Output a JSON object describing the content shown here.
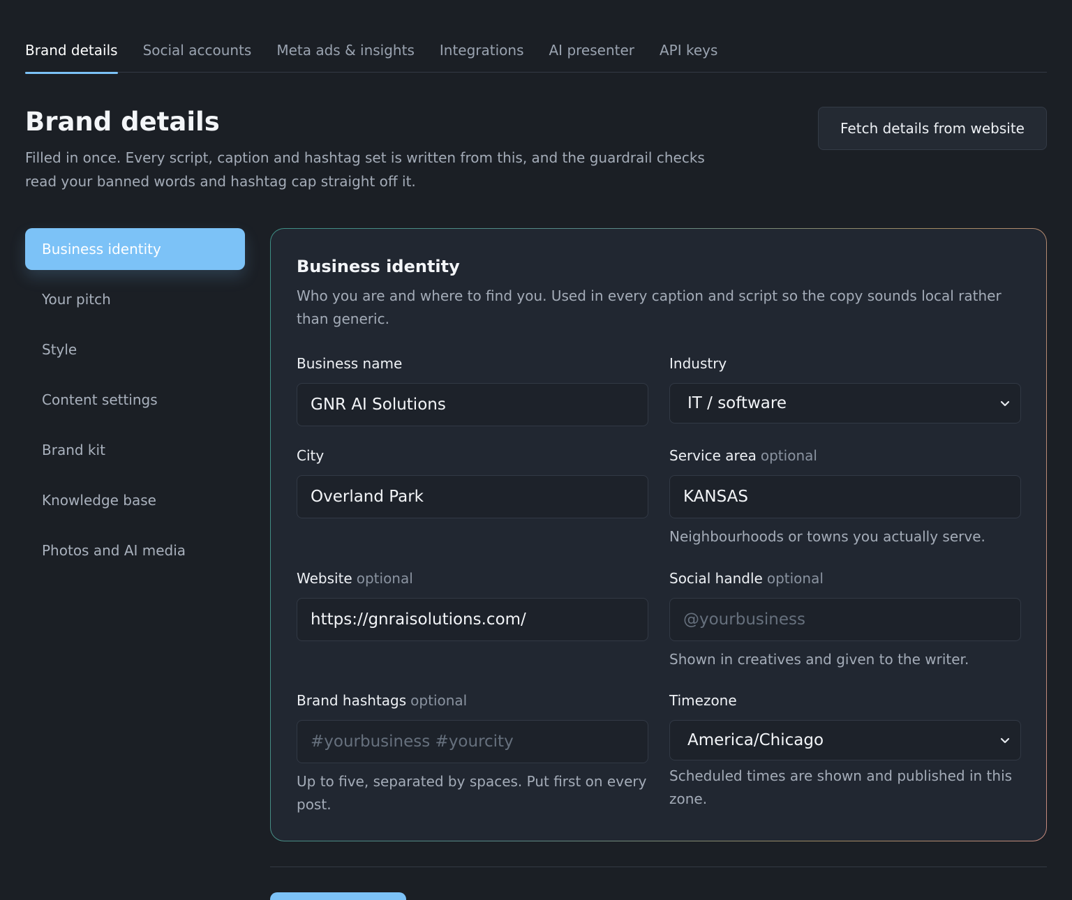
{
  "tabs": [
    {
      "label": "Brand details",
      "active": true
    },
    {
      "label": "Social accounts"
    },
    {
      "label": "Meta ads & insights"
    },
    {
      "label": "Integrations"
    },
    {
      "label": "AI presenter"
    },
    {
      "label": "API keys"
    }
  ],
  "header": {
    "title": "Brand details",
    "description": "Filled in once. Every script, caption and hashtag set is written from this, and the guardrail checks read your banned words and hashtag cap straight off it.",
    "fetch_button": "Fetch details from website"
  },
  "sidebar": {
    "items": [
      {
        "label": "Business identity",
        "active": true
      },
      {
        "label": "Your pitch"
      },
      {
        "label": "Style"
      },
      {
        "label": "Content settings"
      },
      {
        "label": "Brand kit"
      },
      {
        "label": "Knowledge base"
      },
      {
        "label": "Photos and AI media"
      }
    ]
  },
  "card": {
    "title": "Business identity",
    "description": "Who you are and where to find you. Used in every caption and script so the copy sounds local rather than generic.",
    "optional_text": "optional",
    "fields": {
      "business_name": {
        "label": "Business name",
        "value": "GNR AI Solutions"
      },
      "industry": {
        "label": "Industry",
        "value": "IT / software"
      },
      "city": {
        "label": "City",
        "value": "Overland Park"
      },
      "service_area": {
        "label": "Service area",
        "value": "KANSAS",
        "hint": "Neighbourhoods or towns you actually serve."
      },
      "website": {
        "label": "Website",
        "value": "https://gnraisolutions.com/"
      },
      "social_handle": {
        "label": "Social handle",
        "placeholder": "@yourbusiness",
        "hint": "Shown in creatives and given to the writer."
      },
      "brand_hashtags": {
        "label": "Brand hashtags",
        "placeholder": "#yourbusiness #yourcity",
        "hint": "Up to five, separated by spaces. Put first on every post."
      },
      "timezone": {
        "label": "Timezone",
        "value": "America/Chicago",
        "hint": "Scheduled times are shown and published in this zone."
      }
    }
  },
  "colors": {
    "accent": "#7cc2f7",
    "background": "#1b1f25",
    "card": "#212731"
  }
}
